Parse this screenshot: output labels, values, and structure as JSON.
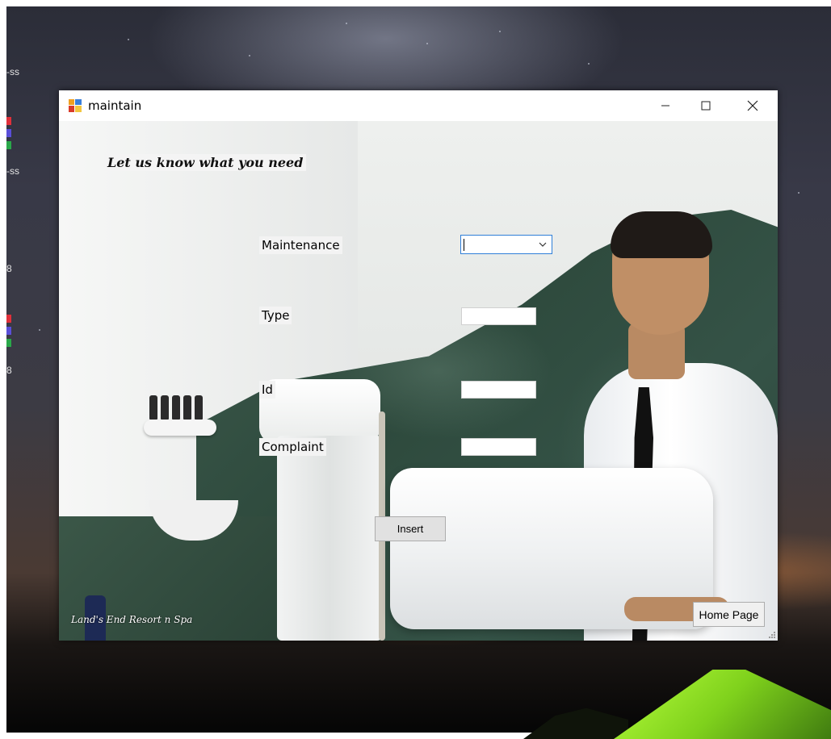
{
  "desktop": {
    "edge_labels": [
      "-ss",
      "-ss",
      "8",
      "8"
    ]
  },
  "window": {
    "title": "maintain",
    "icon": "app-window-icon",
    "controls": {
      "minimize": "minimize-icon",
      "maximize": "maximize-icon",
      "close": "close-icon"
    }
  },
  "form": {
    "heading": "Let us know what  you need",
    "fields": {
      "maintenance_label": "Maintenance",
      "maintenance_value": "",
      "type_label": "Type",
      "type_value": "",
      "id_label": "Id",
      "id_value": "",
      "complaint_label": "Complaint",
      "complaint_value": ""
    },
    "insert_button": "Insert",
    "home_button": "Home Page",
    "brand_text": "Land's End Resort n Spa"
  },
  "colors": {
    "accent": "#2f7fd8",
    "button_face": "#e1e1e1",
    "tent_green": "#9be830"
  }
}
